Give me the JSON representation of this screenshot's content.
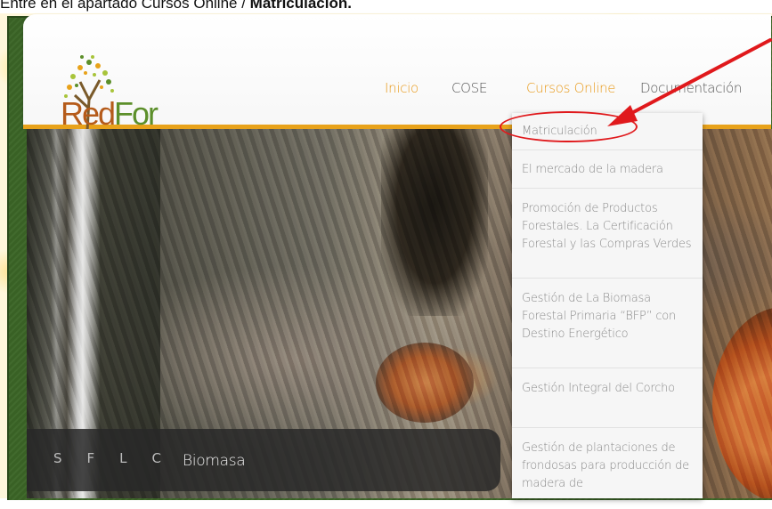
{
  "instruction": {
    "prefix": "Entre en el apartado Cursos Online / ",
    "bold": "Matriculación."
  },
  "logo": {
    "part1": "Red",
    "part2": "For"
  },
  "nav": [
    {
      "label": "Inicio",
      "color": "#e89a1a"
    },
    {
      "label": "COSE",
      "color": "#555555"
    },
    {
      "label": "Cursos Online",
      "color": "#e89a1a"
    },
    {
      "label": "Documentación",
      "color": "#555555"
    }
  ],
  "dropdown": [
    "Matriculación",
    "El mercado de la madera",
    "Promoción de Productos Forestales. La Certificación Forestal y las Compras Verdes",
    "Gestión de La Biomasa Forestal Primaria “BFP” con Destino Energético",
    "Gestión Integral del Corcho",
    "Gestión de plantaciones de frondosas para producción de madera de"
  ],
  "slider": {
    "caption": "Biomasa",
    "dots": [
      "S",
      "F",
      "L",
      "C"
    ]
  },
  "colors": {
    "accent": "#e8a21a",
    "frame_green": "#3f6b2a",
    "annotation_red": "#e0191c"
  }
}
